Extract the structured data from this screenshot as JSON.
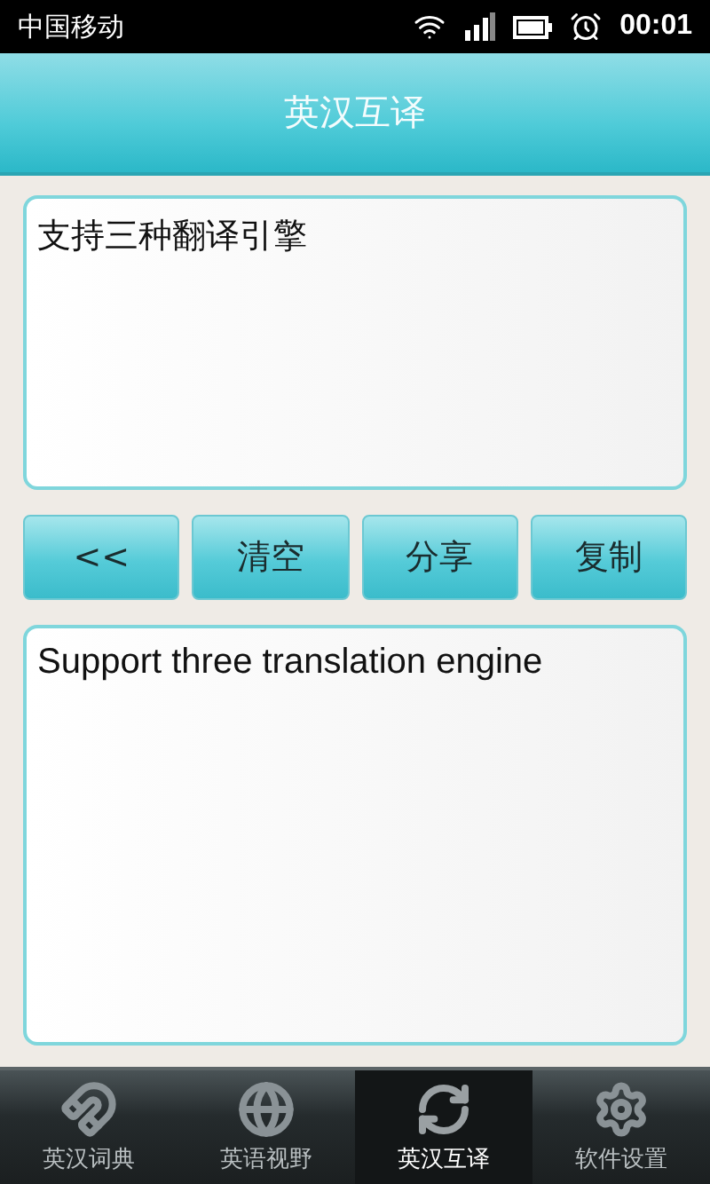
{
  "status_bar": {
    "carrier": "中国移动",
    "time": "00:01"
  },
  "header": {
    "title": "英汉互译"
  },
  "input": {
    "value": "支持三种翻译引擎"
  },
  "buttons": [
    {
      "label": "<<"
    },
    {
      "label": "清空"
    },
    {
      "label": "分享"
    },
    {
      "label": "复制"
    }
  ],
  "output": {
    "value": "Support three translation engine"
  },
  "tabs": [
    {
      "label": "英汉词典",
      "selected": false
    },
    {
      "label": "英语视野",
      "selected": false
    },
    {
      "label": "英汉互译",
      "selected": true
    },
    {
      "label": "软件设置",
      "selected": false
    }
  ]
}
